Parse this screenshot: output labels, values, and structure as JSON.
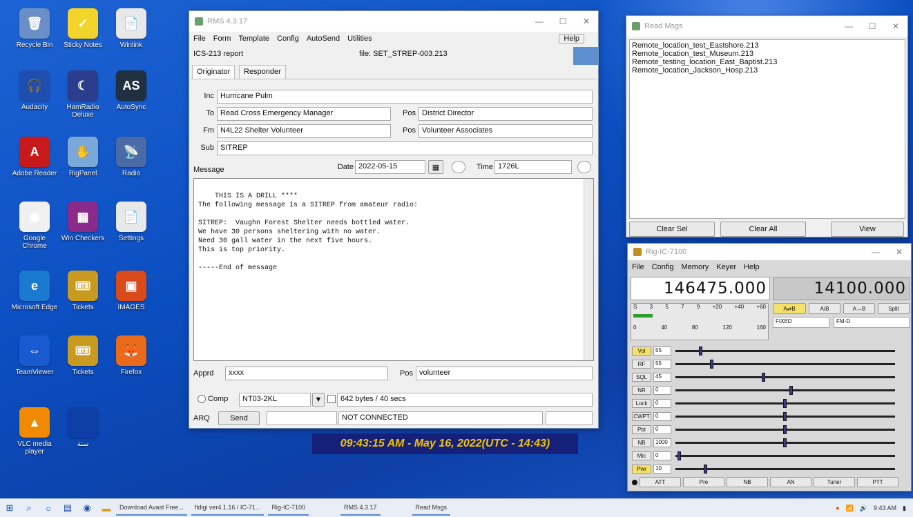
{
  "desktop": {
    "icons": [
      {
        "caption": "Recycle Bin",
        "icon": "recycle-bin-icon",
        "color": "#6a8fc8",
        "glyph": "🗑"
      },
      {
        "caption": "Sticky Notes",
        "icon": "sticky-notes-icon",
        "color": "#f2d42a",
        "glyph": "✓"
      },
      {
        "caption": "Winlink",
        "icon": "document-icon",
        "color": "#e8e8e8",
        "glyph": "📄"
      },
      {
        "caption": "Audacity",
        "icon": "audacity-icon",
        "color": "#1e4fb0",
        "glyph": "🎧"
      },
      {
        "caption": "HamRadio Deluxe",
        "icon": "moon-icon",
        "color": "#2b3d8c",
        "glyph": "☾"
      },
      {
        "caption": "AutoSync",
        "icon": "as-app-icon",
        "color": "#203040",
        "glyph": "AS"
      },
      {
        "caption": "Adobe Reader",
        "icon": "reader-icon",
        "color": "#c81a1a",
        "glyph": "A"
      },
      {
        "caption": "RigPanel",
        "icon": "handshake-icon",
        "color": "#7aa8d8",
        "glyph": "✋"
      },
      {
        "caption": "Radio",
        "icon": "radio-icon",
        "color": "#4a6aa8",
        "glyph": "📡"
      },
      {
        "caption": "Google Chrome",
        "icon": "chrome-icon",
        "color": "#f0f0f0",
        "glyph": "◉"
      },
      {
        "caption": "Win Checkers",
        "icon": "checker-icon",
        "color": "#8a2a8a",
        "glyph": "▦"
      },
      {
        "caption": "Settings",
        "icon": "file-icon",
        "color": "#e8e8e8",
        "glyph": "📄"
      },
      {
        "caption": "Microsoft Edge",
        "icon": "edge-icon",
        "color": "#1a7ad0",
        "glyph": "e"
      },
      {
        "caption": "Tickets",
        "icon": "ticket-icon",
        "color": "#c89a20",
        "glyph": "🎟"
      },
      {
        "caption": "IMAGES",
        "icon": "image-folder-icon",
        "color": "#d84a1a",
        "glyph": "▣"
      },
      {
        "caption": "TeamViewer",
        "icon": "teamviewer-icon",
        "color": "#1a5ad0",
        "glyph": "⇔"
      },
      {
        "caption": "Tickets",
        "icon": "ticket-icon-2",
        "color": "#c89a20",
        "glyph": "🎟"
      },
      {
        "caption": "Firefox",
        "icon": "firefox-icon",
        "color": "#e86a1a",
        "glyph": "🦊"
      },
      {
        "caption": "VLC media player",
        "icon": "vlc-icon",
        "color": "#f08a00",
        "glyph": "▲"
      },
      {
        "caption": "ستة",
        "icon": "text-shortcut-icon",
        "color": "#0d3fa6",
        "glyph": ""
      }
    ]
  },
  "rms": {
    "title": "RMS 4.3.17",
    "menu": [
      "File",
      "Form",
      "Template",
      "Config",
      "AutoSend",
      "Utilities"
    ],
    "help": "Help",
    "report_label": "ICS-213 report",
    "file_label": "file: SET_STREP-003.213",
    "tabs": [
      "Originator",
      "Responder"
    ],
    "inc_label": "Inc",
    "inc_value": "Hurricane Pulm",
    "to_label": "To",
    "to_value": "Read Cross Emergency Manager",
    "pos_label": "Pos",
    "to_pos_value": "District Director",
    "fm_label": "Fm",
    "fm_value": "N4L22 Shelter Volunteer",
    "fm_pos_value": "Volunteer Associates",
    "sub_label": "Sub",
    "sub_value": "SITREP",
    "message_label": "Message",
    "date_label": "Date",
    "date_value": "2022-05-15",
    "time_label": "Time",
    "time_value": "1726L",
    "message_body": "THIS IS A DRILL ****\nThe following message is a SITREP from amateur radio:\n\nSITREP:  Vaughn Forest Shelter needs bottled water.\nWe have 30 persons sheltering with no water.\nNeed 30 gall water in the next five hours.\nThis is top priority.\n\n-----End of message",
    "apprd_label": "Apprd",
    "apprd_value": "xxxx",
    "apprd_pos_label": "Pos",
    "apprd_pos_value": "volunteer",
    "comp_label": "Comp",
    "comp_value": "NT03-2KL",
    "size_text": "642 bytes / 40 secs",
    "arq_label": "ARQ",
    "send_label": "Send",
    "status": "NOT CONNECTED"
  },
  "readmsgs": {
    "title": "Read Msgs",
    "items": [
      "Remote_location_test_Eastshore.213",
      "Remote_location_test_Museum.213",
      "Remote_testing_location_East_Baptist.213",
      "Remote_location_Jackson_Hosp.213"
    ],
    "clear_sel": "Clear Sel",
    "clear_all": "Clear All",
    "view": "View"
  },
  "rig": {
    "title": "Rig-IC-7100",
    "menu": [
      "File",
      "Config",
      "Memory",
      "Keyer",
      "Help"
    ],
    "freq_a": "146475.000",
    "freq_b": "14100.000",
    "btn_a": "A⇄B",
    "btn_ab": "A/B",
    "btn_a_to_b": "A→B",
    "btn_split": "Split",
    "mode_1": "FIXED",
    "mode_2": "FM-D",
    "meter_scale": [
      "S",
      "3",
      "5",
      "7",
      "9",
      "+20",
      "+40",
      "+60"
    ],
    "power_scale": [
      "0",
      "40",
      "80",
      "120",
      "160"
    ],
    "sliders": [
      {
        "label": "Vol",
        "value": "55",
        "pos": 0.11
      },
      {
        "label": "RF",
        "value": "55",
        "pos": 0.16
      },
      {
        "label": "SQL",
        "value": "45",
        "pos": 0.4
      },
      {
        "label": "NR",
        "value": "0",
        "pos": 0.53
      },
      {
        "label": "Lock",
        "value": "0",
        "pos": 0.5
      },
      {
        "label": "CWPT",
        "value": "0",
        "pos": 0.5
      },
      {
        "label": "Pbt",
        "value": "0",
        "pos": 0.5
      },
      {
        "label": "NB",
        "value": "1000",
        "pos": 0.5
      },
      {
        "label": "Mic",
        "value": "0",
        "pos": 0.01
      },
      {
        "label": "Pwr",
        "value": "10",
        "pos": 0.13
      }
    ],
    "bottom_buttons": [
      "ATT",
      "Pre",
      "NB",
      "AN",
      "Tuner",
      "PTT"
    ]
  },
  "clock": {
    "time": "09:43:15 AM - May 16, 2022",
    "utc": "(UTC - 14:43)"
  },
  "taskbar": {
    "tasks": [
      "Download Avast Free...",
      "fldigi ver4.1.16 / IC-71...",
      "Rig-IC-7100",
      "RMS 4.3.17",
      "Read Msgs"
    ],
    "time": "9:43 AM"
  },
  "colors": {
    "desktop_blue": "#0b4fc2",
    "clock_bg": "#15207a",
    "clock_fg": "#f5c400"
  }
}
